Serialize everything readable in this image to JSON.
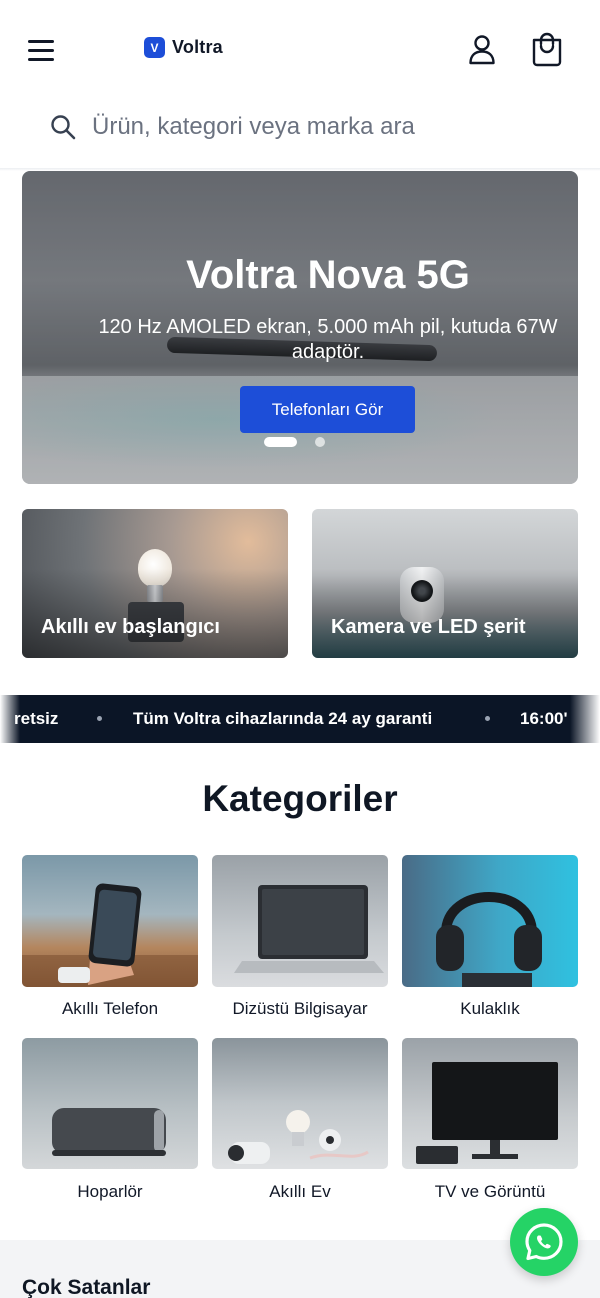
{
  "header": {
    "brand": "Voltra",
    "brand_mark": "V",
    "icons": [
      "menu-icon",
      "user-icon",
      "cart-icon"
    ]
  },
  "search": {
    "placeholder": "Ürün, kategori veya marka ara",
    "value": ""
  },
  "hero": {
    "title": "Voltra Nova 5G",
    "subtitle": "120 Hz AMOLED ekran, 5.000 mAh pil, kutuda 67W adaptör.",
    "button_label": "Telefonları Gör",
    "slides_total": 2,
    "slide_active": 1
  },
  "promos": [
    {
      "label": "Akıllı ev başlangıcı"
    },
    {
      "label": "Kamera ve LED şerit"
    }
  ],
  "marquee": {
    "items": [
      "retsiz",
      "Tüm Voltra cihazlarında 24 ay garanti",
      "16:00'"
    ]
  },
  "categories": {
    "title": "Kategoriler",
    "items": [
      {
        "label": "Akıllı Telefon"
      },
      {
        "label": "Dizüstü Bilgisayar"
      },
      {
        "label": "Kulaklık"
      },
      {
        "label": "Hoparlör"
      },
      {
        "label": "Akıllı Ev"
      },
      {
        "label": "TV ve Görüntü"
      }
    ]
  },
  "best_sellers": {
    "title": "Çok Satanlar"
  },
  "colors": {
    "accent": "#1d4ed8",
    "marquee_bg": "#0b1526",
    "whatsapp": "#25d366",
    "text": "#0f1724"
  }
}
